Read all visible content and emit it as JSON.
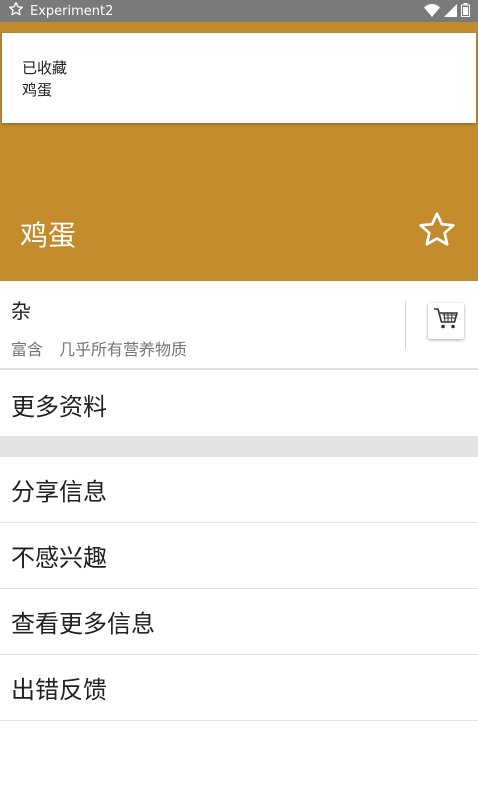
{
  "status_bar": {
    "app_title": "Experiment2",
    "icons": [
      "star-outline-icon",
      "wifi-icon",
      "signal-icon",
      "battery-icon"
    ]
  },
  "toast": {
    "line1": "已收藏",
    "line2": "鸡蛋"
  },
  "header": {
    "title": "鸡蛋",
    "favorite_icon": "star-outline-icon",
    "color": "#c48b2c"
  },
  "info": {
    "category": "杂",
    "nutrition": "富含　几乎所有营养物质",
    "cart_icon": "shopping-cart-icon"
  },
  "more_info": {
    "label": "更多资料"
  },
  "menu": {
    "items": [
      {
        "label": "分享信息"
      },
      {
        "label": "不感兴趣"
      },
      {
        "label": "查看更多信息"
      },
      {
        "label": "出错反馈"
      }
    ]
  }
}
